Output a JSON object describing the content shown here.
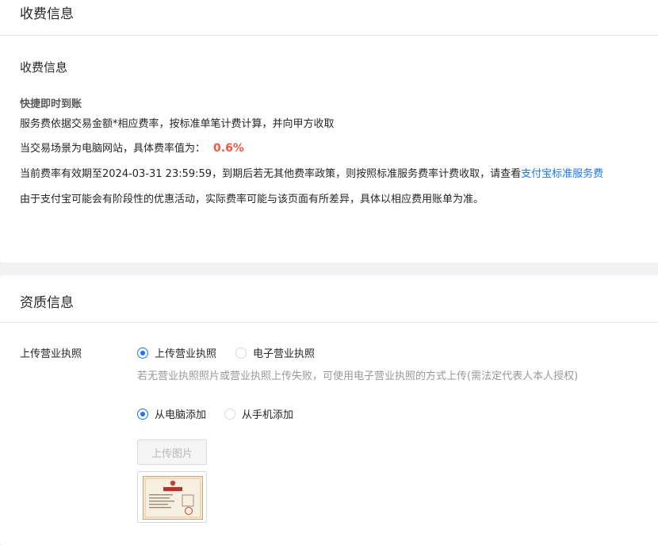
{
  "fee_section": {
    "header_title": "收费信息",
    "sub_title": "收费信息",
    "product_name": "快捷即时到账",
    "desc_line": "服务费依据交易金额*相应费率，按标准单笔计费计算，并向甲方收取",
    "scene_line": "当交易场景为电脑网站，具体费率值为：",
    "rate_value": "0.6%",
    "validity_line": "当前费率有效期至2024-03-31 23:59:59，到期后若无其他费率政策，则按照标准服务费率计费收取，请查看",
    "validity_link": "支付宝标准服务费",
    "disclaimer_line": "由于支付宝可能会有阶段性的优惠活动，实际费率可能与该页面有所差异，具体以相应费用账单为准。"
  },
  "qualification_section": {
    "header_title": "资质信息",
    "license_label": "上传营业执照",
    "license_options": [
      {
        "label": "上传营业执照",
        "selected": true
      },
      {
        "label": "电子营业执照",
        "selected": false
      }
    ],
    "license_hint": "若无营业执照照片或营业执照上传失败，可使用电子营业执照的方式上传(需法定代表人本人授权)",
    "source_options": [
      {
        "label": "从电脑添加",
        "selected": true
      },
      {
        "label": "从手机添加",
        "selected": false
      }
    ],
    "upload_button_label": "上传图片",
    "thumbnail_icon": "business-license-image",
    "accent_color": "#1677ff",
    "rate_color": "#f5533d"
  }
}
